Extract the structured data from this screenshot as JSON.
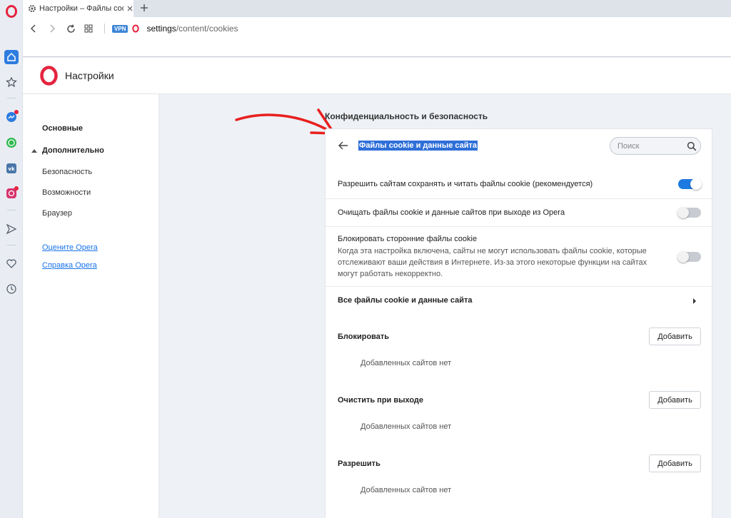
{
  "browser": {
    "tab_title": "Настройки – Файлы cookie и данные сайта",
    "vpn_label": "VPN",
    "url_host": "settings",
    "url_path": "/content/cookies"
  },
  "header": {
    "title": "Настройки"
  },
  "nav": {
    "items": [
      {
        "label": "Основные"
      },
      {
        "label": "Дополнительно"
      },
      {
        "label": "Безопасность"
      },
      {
        "label": "Возможности"
      },
      {
        "label": "Браузер"
      }
    ],
    "links": [
      {
        "label": "Оцените Opera"
      },
      {
        "label": "Справка Opera"
      }
    ]
  },
  "main": {
    "section_title": "Конфиденциальность и безопасность",
    "page_title": "Файлы cookie и данные сайта",
    "search_placeholder": "Поиск",
    "settings": [
      {
        "label": "Разрешить сайтам сохранять и читать файлы cookie (рекомендуется)",
        "enabled": true
      },
      {
        "label": "Очищать файлы cookie и данные сайтов при выходе из Opera",
        "enabled": false
      },
      {
        "label": "Блокировать сторонние файлы cookie",
        "description": "Когда эта настройка включена, сайты не могут использовать файлы cookie, которые отслеживают ваши действия в Интернете. Из-за этого некоторые функции на сайтах могут работать некорректно.",
        "enabled": false
      }
    ],
    "all_cookies_label": "Все файлы cookie и данные сайта",
    "groups": [
      {
        "label": "Блокировать",
        "button": "Добавить",
        "empty": "Добавленных сайтов нет"
      },
      {
        "label": "Очистить при выходе",
        "button": "Добавить",
        "empty": "Добавленных сайтов нет"
      },
      {
        "label": "Разрешить",
        "button": "Добавить",
        "empty": "Добавленных сайтов нет"
      }
    ]
  },
  "colors": {
    "accent": "#1d7ae0",
    "opera_red": "#e4243f",
    "selection": "#2f6fd8",
    "annotation_arrow": "#e8201f"
  }
}
